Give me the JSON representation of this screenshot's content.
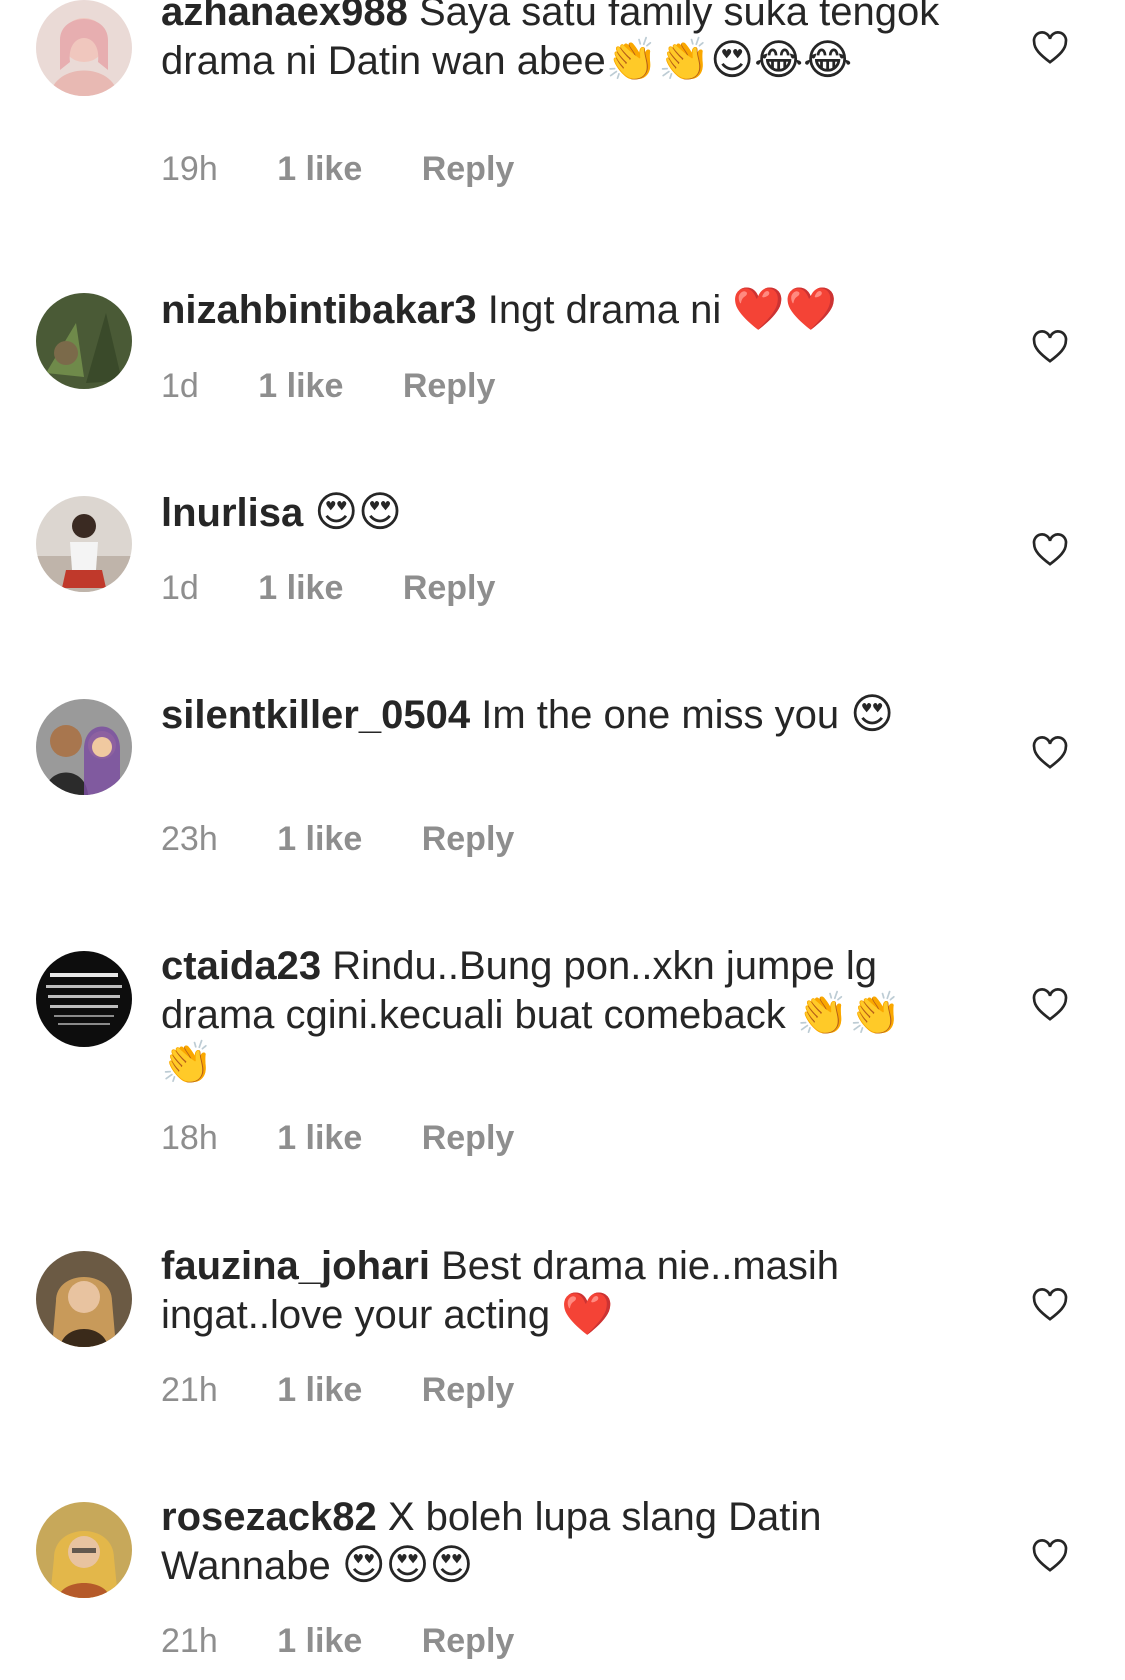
{
  "comments": [
    {
      "username": "azhanaex988",
      "text": "Saya satu family suka tengok drama ni Datin wan abee",
      "emoji": "👏👏😍😂😂",
      "time": "19h",
      "likes": "1 like",
      "reply": "Reply",
      "avatar_colors": [
        "#e9c9c4",
        "#c98a86"
      ]
    },
    {
      "username": "nizahbintibakar3",
      "text": "Ingt drama ni",
      "emoji": "❤️❤️",
      "time": "1d",
      "likes": "1 like",
      "reply": "Reply",
      "avatar_colors": [
        "#4f6b3a",
        "#2f3f22"
      ]
    },
    {
      "username": "lnurlisa",
      "text": "",
      "emoji": "😍😍",
      "time": "1d",
      "likes": "1 like",
      "reply": "Reply",
      "avatar_colors": [
        "#d9d2cc",
        "#c0392b"
      ]
    },
    {
      "username": "silentkiller_0504",
      "text": "Im the one miss you",
      "emoji": "😍",
      "time": "23h",
      "likes": "1 like",
      "reply": "Reply",
      "avatar_colors": [
        "#8a8a8a",
        "#7b4fa0"
      ]
    },
    {
      "username": "ctaida23",
      "text": "Rindu..Bung pon..xkn jumpe lg drama cgini.kecuali buat comeback",
      "emoji": "👏👏👏",
      "time": "18h",
      "likes": "1 like",
      "reply": "Reply",
      "avatar_colors": [
        "#111111",
        "#ffffff"
      ]
    },
    {
      "username": "fauzina_johari",
      "text": "Best drama nie..masih ingat..love your acting",
      "emoji": "❤️",
      "time": "21h",
      "likes": "1 like",
      "reply": "Reply",
      "avatar_colors": [
        "#6b5a44",
        "#c89a5a"
      ]
    },
    {
      "username": "rosezack82",
      "text": "X boleh lupa slang Datin Wannabe",
      "emoji": "😍😍😍",
      "time": "21h",
      "likes": "1 like",
      "reply": "Reply",
      "avatar_colors": [
        "#b99a4f",
        "#e3b74a"
      ]
    }
  ]
}
